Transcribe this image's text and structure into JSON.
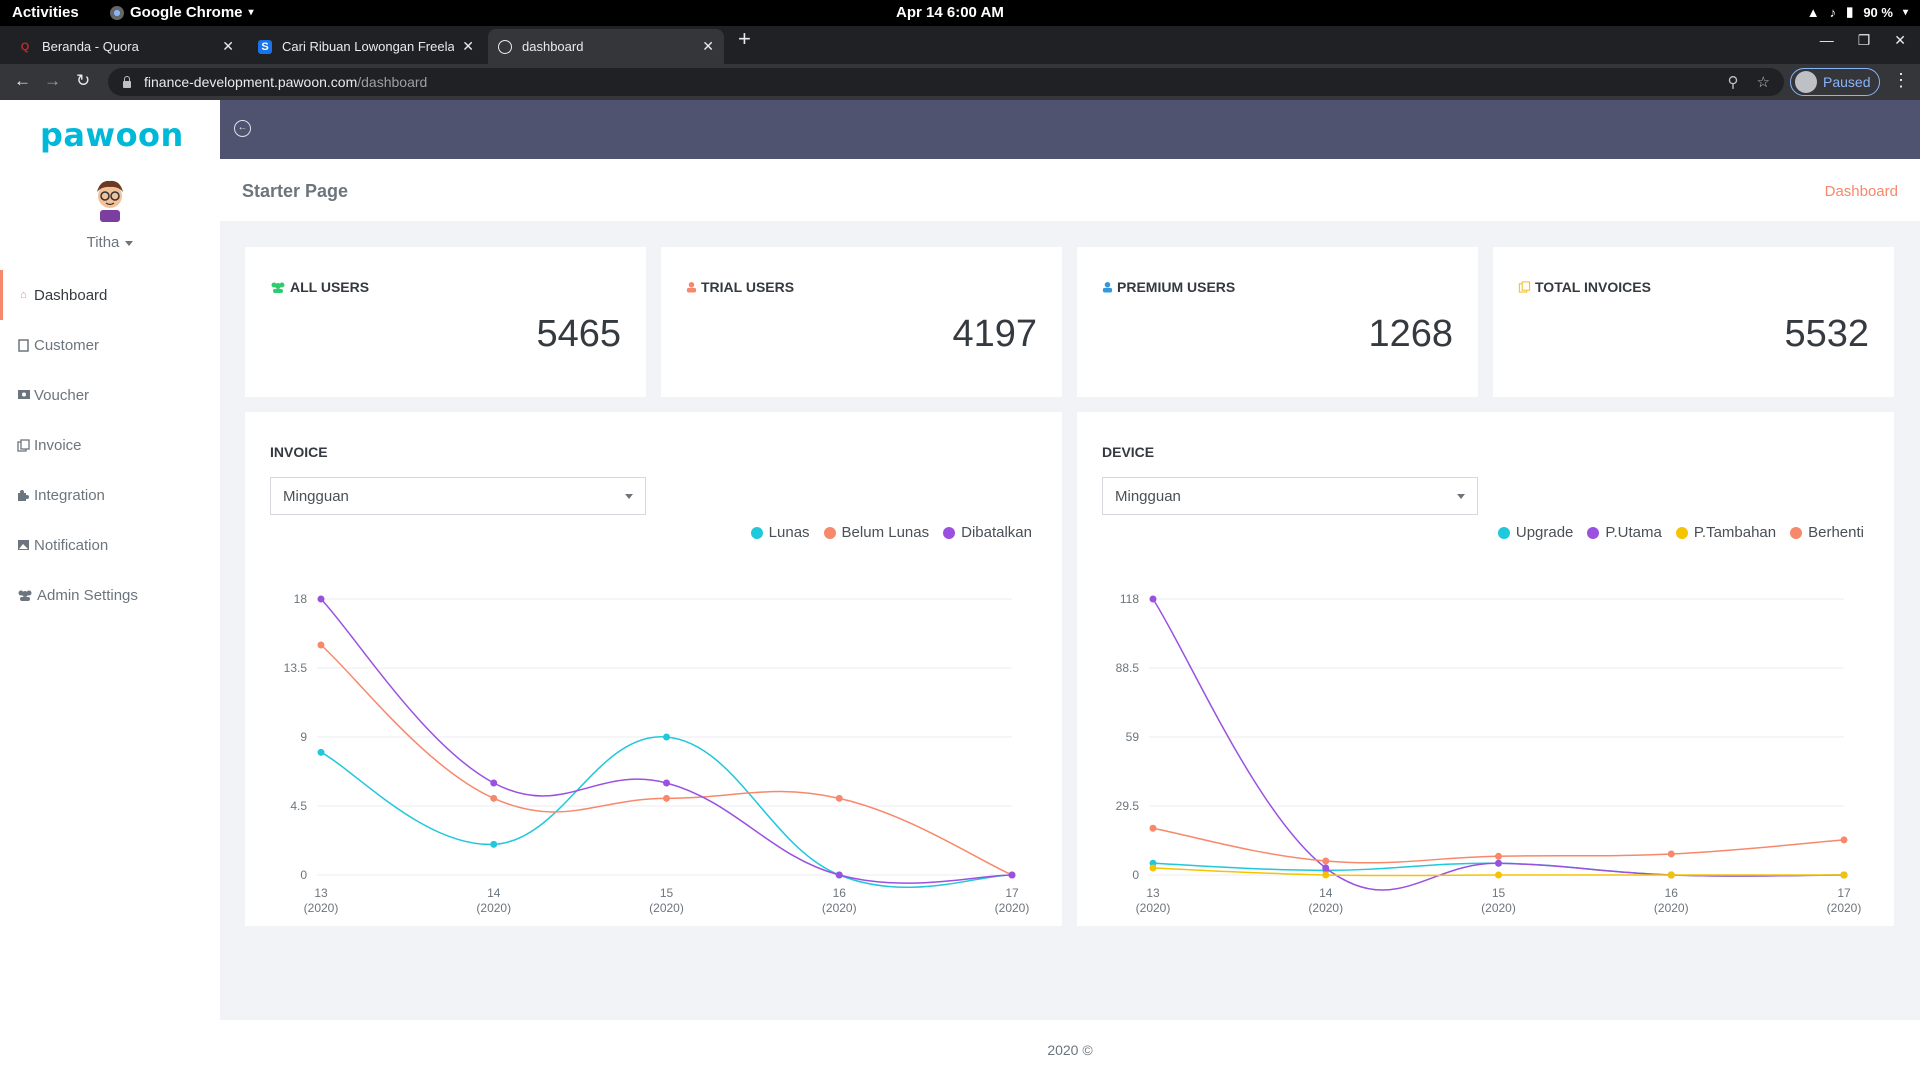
{
  "os": {
    "activities": "Activities",
    "app_name": "Google Chrome",
    "datetime": "Apr 14  6:00 AM",
    "battery": "90 %"
  },
  "browser": {
    "tabs": [
      {
        "title": "Beranda - Quora",
        "favicon": "Q",
        "color": "#b92b27"
      },
      {
        "title": "Cari Ribuan Lowongan Freelan",
        "favicon": "S",
        "color": "#1a73e8"
      },
      {
        "title": "dashboard",
        "favicon": "globe",
        "color": "#9aa0a6"
      }
    ],
    "url_host": "finance-development.pawoon.com",
    "url_path": "/dashboard",
    "profile_status": "Paused"
  },
  "sidebar": {
    "logo": "pawoon",
    "user": "Titha",
    "items": [
      {
        "label": "Dashboard",
        "icon": "home-icon",
        "active": true
      },
      {
        "label": "Customer",
        "icon": "building-icon",
        "active": false
      },
      {
        "label": "Voucher",
        "icon": "ticket-icon",
        "active": false
      },
      {
        "label": "Invoice",
        "icon": "copy-icon",
        "active": false
      },
      {
        "label": "Integration",
        "icon": "puzzle-icon",
        "active": false
      },
      {
        "label": "Notification",
        "icon": "image-icon",
        "active": false
      },
      {
        "label": "Admin Settings",
        "icon": "users-icon",
        "active": false
      }
    ]
  },
  "header": {
    "page_title": "Starter Page",
    "breadcrumb": "Dashboard"
  },
  "stats": [
    {
      "label": "ALL USERS",
      "value": "5465",
      "icon": "users-icon",
      "color": "#2ecc71"
    },
    {
      "label": "TRIAL USERS",
      "value": "4197",
      "icon": "user-icon",
      "color": "#f7886b"
    },
    {
      "label": "PREMIUM USERS",
      "value": "1268",
      "icon": "user-icon",
      "color": "#3498db"
    },
    {
      "label": "TOTAL INVOICES",
      "value": "5532",
      "icon": "copy-icon",
      "color": "#f5c542"
    }
  ],
  "charts": {
    "invoice": {
      "title": "INVOICE",
      "period": "Mingguan"
    },
    "device": {
      "title": "DEVICE",
      "period": "Mingguan"
    }
  },
  "chart_data": [
    {
      "type": "line",
      "title": "INVOICE",
      "x": [
        "13",
        "14",
        "15",
        "16",
        "17"
      ],
      "x_sub": "(2020)",
      "y_ticks": [
        "0",
        "4.5",
        "9",
        "13.5",
        "18"
      ],
      "ylim": [
        0,
        18
      ],
      "legend": "top-right",
      "grid": true,
      "series": [
        {
          "name": "Lunas",
          "color": "#1fc8db",
          "values": [
            8,
            2,
            9,
            0,
            0
          ]
        },
        {
          "name": "Belum Lunas",
          "color": "#f7886b",
          "values": [
            15,
            5,
            5,
            5,
            0
          ]
        },
        {
          "name": "Dibatalkan",
          "color": "#9b51e0",
          "values": [
            18,
            6,
            6,
            0,
            0
          ]
        }
      ]
    },
    {
      "type": "line",
      "title": "DEVICE",
      "x": [
        "13",
        "14",
        "15",
        "16",
        "17"
      ],
      "x_sub": "(2020)",
      "y_ticks": [
        "0",
        "29.5",
        "59",
        "88.5",
        "118"
      ],
      "ylim": [
        0,
        118
      ],
      "legend": "top-right",
      "grid": true,
      "series": [
        {
          "name": "Upgrade",
          "color": "#1fc8db",
          "values": [
            5,
            2,
            5,
            0,
            0
          ]
        },
        {
          "name": "P.Utama",
          "color": "#9b51e0",
          "values": [
            118,
            3,
            5,
            0,
            0
          ]
        },
        {
          "name": "P.Tambahan",
          "color": "#f5c400",
          "values": [
            3,
            0,
            0,
            0,
            0
          ]
        },
        {
          "name": "Berhenti",
          "color": "#f7886b",
          "values": [
            20,
            6,
            8,
            9,
            15
          ]
        }
      ]
    }
  ],
  "footer": "2020 ©"
}
